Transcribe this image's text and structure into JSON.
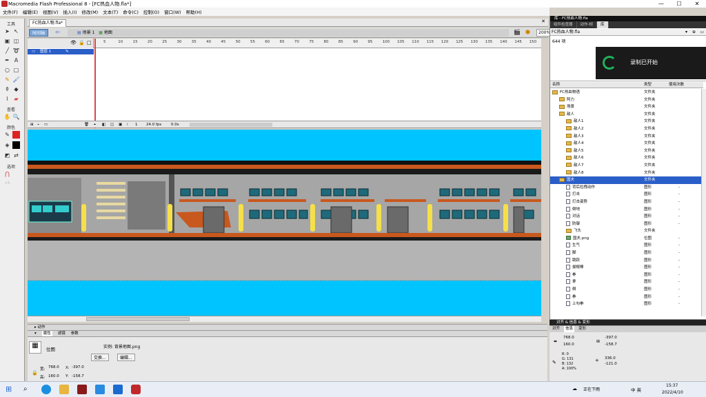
{
  "window": {
    "title": "Macromedia Flash Professional 8 - [FC热血人物.fla*]",
    "minimize": "—",
    "maximize": "☐",
    "close": "✕"
  },
  "menu": [
    "文件(F)",
    "编辑(E)",
    "视图(V)",
    "插入(I)",
    "修改(M)",
    "文本(T)",
    "命令(C)",
    "控制(O)",
    "窗口(W)",
    "帮助(H)"
  ],
  "tools": {
    "header": "工具",
    "view_label": "查看",
    "colors_label": "颜色",
    "options_label": "选项"
  },
  "document": {
    "tab": "FC热血人物.fla*",
    "timeline_button": "时间轴",
    "scene": "场景 1",
    "symbol": "地图",
    "zoom": "200%"
  },
  "timeline": {
    "layer_name": "图层 1",
    "frame_numbers": [
      "5",
      "10",
      "15",
      "20",
      "25",
      "30",
      "35",
      "40",
      "45",
      "50",
      "55",
      "60",
      "65",
      "70",
      "75",
      "80",
      "85",
      "90",
      "95",
      "100",
      "105",
      "110",
      "115",
      "120",
      "125",
      "130",
      "135",
      "140",
      "145",
      "150"
    ],
    "current_frame": "1",
    "fps": "24.0 fps",
    "time": "0.0s"
  },
  "library": {
    "panel_title": "库 - FC热血人物.fla",
    "tabs": [
      "组件检查器",
      "动作-帧",
      "库"
    ],
    "selected_tab": "库",
    "doc": "FC热血人物.fla",
    "item_count": "644 项",
    "columns": {
      "name": "名称",
      "type": "类型",
      "usage": "使用次数"
    },
    "items": [
      {
        "name": "FC热血物语",
        "type": "文件夹",
        "count": "",
        "kind": "folder",
        "indent": 0
      },
      {
        "name": "阿力",
        "type": "文件夹",
        "count": "",
        "kind": "folder",
        "indent": 1
      },
      {
        "name": "场景",
        "type": "文件夹",
        "count": "",
        "kind": "folder",
        "indent": 1
      },
      {
        "name": "敌人",
        "type": "文件夹",
        "count": "",
        "kind": "folder",
        "indent": 1
      },
      {
        "name": "敌人1",
        "type": "文件夹",
        "count": "",
        "kind": "folder",
        "indent": 2
      },
      {
        "name": "敌人2",
        "type": "文件夹",
        "count": "",
        "kind": "folder",
        "indent": 2
      },
      {
        "name": "敌人3",
        "type": "文件夹",
        "count": "",
        "kind": "folder",
        "indent": 2
      },
      {
        "name": "敌人4",
        "type": "文件夹",
        "count": "",
        "kind": "folder",
        "indent": 2
      },
      {
        "name": "敌人5",
        "type": "文件夹",
        "count": "",
        "kind": "folder",
        "indent": 2
      },
      {
        "name": "敌人6",
        "type": "文件夹",
        "count": "",
        "kind": "folder",
        "indent": 2
      },
      {
        "name": "敌人7",
        "type": "文件夹",
        "count": "",
        "kind": "folder",
        "indent": 2
      },
      {
        "name": "敌人8",
        "type": "文件夹",
        "count": "",
        "kind": "folder",
        "indent": 2
      },
      {
        "name": "国夫",
        "type": "文件夹",
        "count": "",
        "kind": "folder",
        "indent": 1,
        "selected": true
      },
      {
        "name": "背后拉拽动作",
        "type": "图形",
        "count": "-",
        "kind": "graphic",
        "indent": 2
      },
      {
        "name": "打击",
        "type": "图形",
        "count": "-",
        "kind": "graphic",
        "indent": 2
      },
      {
        "name": "打击姿势",
        "type": "图形",
        "count": "-",
        "kind": "graphic",
        "indent": 2
      },
      {
        "name": "倒地",
        "type": "图形",
        "count": "-",
        "kind": "graphic",
        "indent": 2
      },
      {
        "name": "对话",
        "type": "图形",
        "count": "-",
        "kind": "graphic",
        "indent": 2
      },
      {
        "name": "防御",
        "type": "图形",
        "count": "-",
        "kind": "graphic",
        "indent": 2
      },
      {
        "name": "飞头",
        "type": "文件夹",
        "count": "",
        "kind": "folder",
        "indent": 2
      },
      {
        "name": "国夫.png",
        "type": "位图",
        "count": "-",
        "kind": "bitmap",
        "indent": 2
      },
      {
        "name": "生气",
        "type": "图形",
        "count": "-",
        "kind": "graphic",
        "indent": 2
      },
      {
        "name": "脚",
        "type": "图形",
        "count": "-",
        "kind": "graphic",
        "indent": 2
      },
      {
        "name": "跳跃",
        "type": "图形",
        "count": "-",
        "kind": "graphic",
        "indent": 2
      },
      {
        "name": "拔棍棒",
        "type": "图形",
        "count": "-",
        "kind": "graphic",
        "indent": 2
      },
      {
        "name": "拳",
        "type": "图形",
        "count": "-",
        "kind": "graphic",
        "indent": 2
      },
      {
        "name": "拿",
        "type": "图形",
        "count": "-",
        "kind": "graphic",
        "indent": 2
      },
      {
        "name": "倒",
        "type": "图形",
        "count": "-",
        "kind": "graphic",
        "indent": 2
      },
      {
        "name": "拳",
        "type": "图形",
        "count": "-",
        "kind": "graphic",
        "indent": 2
      },
      {
        "name": "上勾拳",
        "type": "图形",
        "count": "-",
        "kind": "graphic",
        "indent": 2
      }
    ]
  },
  "toast": {
    "text": "录制已开始"
  },
  "bottom_panels": {
    "collapsed": "动作",
    "tabs": [
      "属性",
      "滤镜",
      "参数"
    ]
  },
  "properties": {
    "symbol_type": "位图",
    "instance_of": "实例: 背景地图.png",
    "swap_button": "交换...",
    "edit_button": "编辑...",
    "w": "768.0",
    "h": "160.0",
    "x": "-397.0",
    "y": "-158.7",
    "w_label": "宽:",
    "h_label": "高:",
    "x_label": "X:",
    "y_label": "Y:"
  },
  "transform": {
    "title": "对齐 & 信息 & 变形",
    "tabs": [
      "对齐",
      "信息",
      "变形"
    ],
    "w": "768.0",
    "h": "160.0",
    "x": "-397.0",
    "y": "-158.7",
    "r": "R: 0",
    "g": "G: 131",
    "b": "B: 132",
    "a": "A: 100%",
    "cx": "336.0",
    "cy": "-121.0"
  },
  "taskbar": {
    "status": "正在下雨",
    "ime": "中 英",
    "time": "15:37",
    "date": "2022/4/10"
  }
}
